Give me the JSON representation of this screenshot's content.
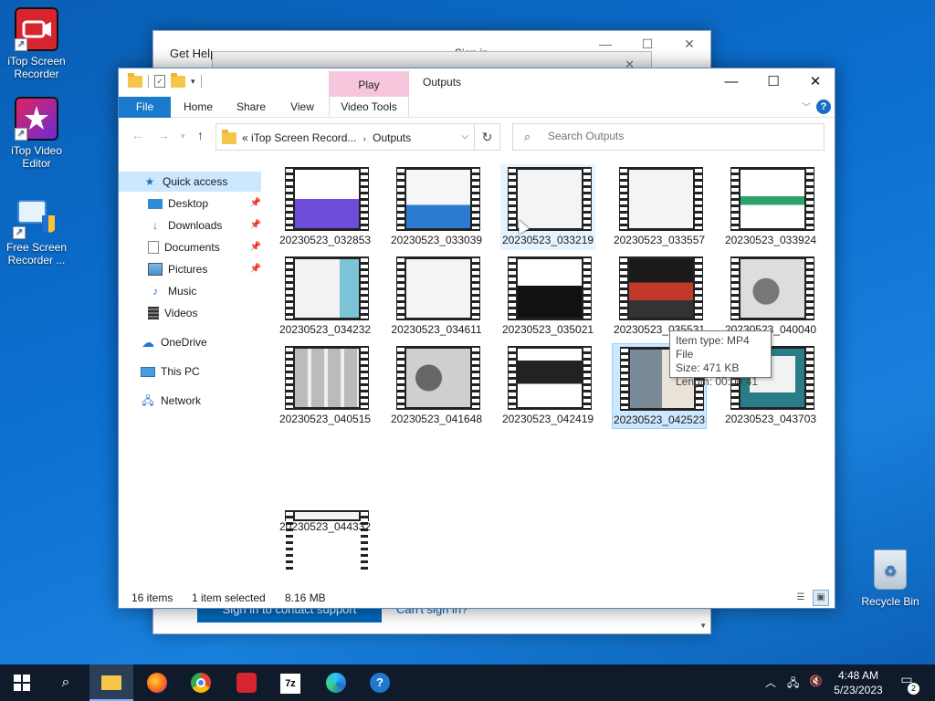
{
  "desktop": {
    "icons": [
      {
        "label": "iTop Screen Recorder",
        "icon": "screen-recorder-icon"
      },
      {
        "label": "iTop Video Editor",
        "icon": "video-editor-icon"
      },
      {
        "label": "Free Screen Recorder ...",
        "icon": "free-screen-recorder-icon"
      }
    ],
    "recycle_bin": "Recycle Bin"
  },
  "back_window": {
    "title": "Get Help",
    "signin": "Sign in",
    "button": "Sign in to contact support",
    "link": "Can't sign in?"
  },
  "explorer": {
    "title": "Outputs",
    "context_tab": "Play",
    "ribbon_tabs": [
      "File",
      "Home",
      "Share",
      "View",
      "Video Tools"
    ],
    "address": {
      "crumb1": "iTop Screen Record...",
      "crumb2": "Outputs",
      "prefix": "«"
    },
    "search_placeholder": "Search Outputs",
    "sidebar": [
      {
        "label": "Quick access",
        "icon": "star-icon"
      },
      {
        "label": "Desktop",
        "icon": "desktop-icon"
      },
      {
        "label": "Downloads",
        "icon": "download-icon"
      },
      {
        "label": "Documents",
        "icon": "documents-icon"
      },
      {
        "label": "Pictures",
        "icon": "pictures-icon"
      },
      {
        "label": "Music",
        "icon": "music-icon"
      },
      {
        "label": "Videos",
        "icon": "videos-icon"
      },
      {
        "label": "OneDrive",
        "icon": "cloud-icon"
      },
      {
        "label": "This PC",
        "icon": "computer-icon"
      },
      {
        "label": "Network",
        "icon": "network-icon"
      }
    ],
    "files": [
      "20230523_032853",
      "20230523_033039",
      "20230523_033219",
      "20230523_033557",
      "20230523_033924",
      "20230523_034232",
      "20230523_034611",
      "20230523_035021",
      "20230523_035531",
      "20230523_040040",
      "20230523_040515",
      "20230523_041648",
      "20230523_042419",
      "20230523_042523",
      "20230523_043703",
      "20230523_044332"
    ],
    "tooltip": {
      "type": "Item type: MP4 File",
      "size": "Size: 471 KB",
      "length": "Length: 00:00:41"
    },
    "status": {
      "count": "16 items",
      "selected": "1 item selected",
      "size": "8.16 MB"
    }
  },
  "taskbar": {
    "time": "4:48 AM",
    "date": "5/23/2023",
    "notifications": "2"
  },
  "colors": {
    "accent": "#1979ca",
    "selection": "#cce8ff",
    "context_tab": "#f6c6dc",
    "taskbar": "#0f1a2b"
  }
}
